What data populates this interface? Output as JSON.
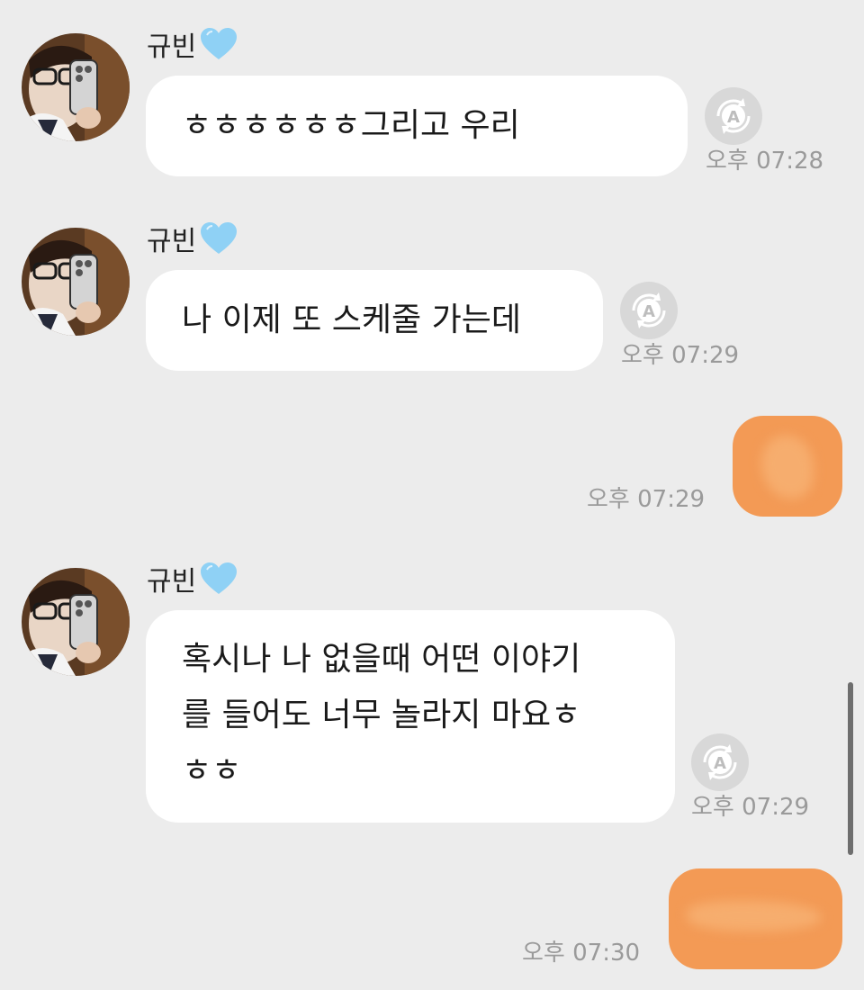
{
  "sender_name": "규빈",
  "colors": {
    "background": "#ececec",
    "bubble_incoming": "#ffffff",
    "bubble_outgoing": "#f39a55",
    "timestamp": "#9a9a9a",
    "heart": "#8fd1f5"
  },
  "icons": {
    "heart": "light-blue-heart-icon",
    "translate": "auto-translate-icon"
  },
  "translate_label": "A",
  "messages": [
    {
      "direction": "incoming",
      "text": "ㅎㅎㅎㅎㅎㅎ그리고 우리",
      "time": "오후 07:28"
    },
    {
      "direction": "incoming",
      "text": "나 이제 또 스케줄 가는데",
      "time": "오후 07:29"
    },
    {
      "direction": "outgoing",
      "text": "",
      "time": "오후 07:29"
    },
    {
      "direction": "incoming",
      "lines": [
        "혹시나 나 없을때 어떤 이야기",
        "를 들어도 너무 놀라지 마요ㅎ",
        "ㅎㅎ"
      ],
      "time": "오후 07:29"
    },
    {
      "direction": "outgoing",
      "text": "",
      "time": "오후 07:30"
    }
  ]
}
